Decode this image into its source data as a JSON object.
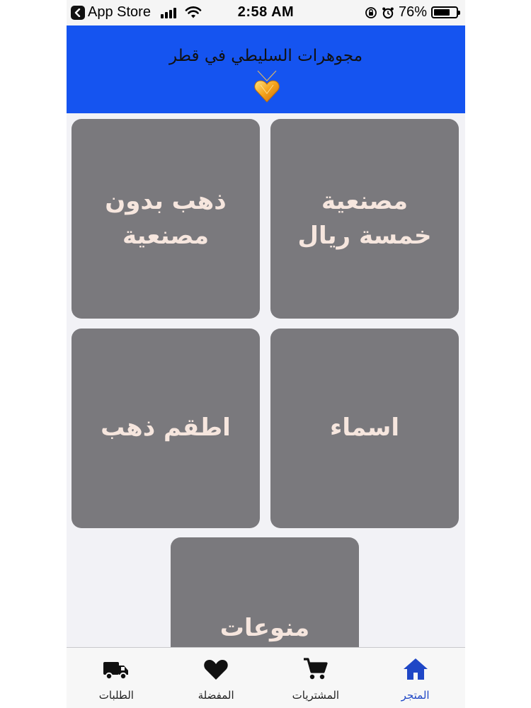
{
  "status_bar": {
    "back_label": "App Store",
    "time": "2:58 AM",
    "battery": "76%",
    "battery_level": 0.76
  },
  "header": {
    "title": "مجوهرات السليطي في قطر",
    "logo_icon": "gold-heart-pendant-icon"
  },
  "categories": [
    {
      "label": "مصنعية خمسة ريال"
    },
    {
      "label": "ذهب بدون مصنعية"
    },
    {
      "label": "اسماء"
    },
    {
      "label": "اطقم ذهب"
    },
    {
      "label": "منوعات"
    }
  ],
  "tab_bar": {
    "tabs": [
      {
        "label": "الطلبات",
        "icon": "truck-icon"
      },
      {
        "label": "المفضلة",
        "icon": "heart-icon"
      },
      {
        "label": "المشتريات",
        "icon": "cart-icon"
      },
      {
        "label": "المتجر",
        "icon": "home-icon",
        "active": true
      }
    ]
  },
  "colors": {
    "header_bg": "#1554f0",
    "tile_bg": "#7a797d",
    "tile_text": "#f6e6de",
    "active_tab": "#1f47c6"
  }
}
